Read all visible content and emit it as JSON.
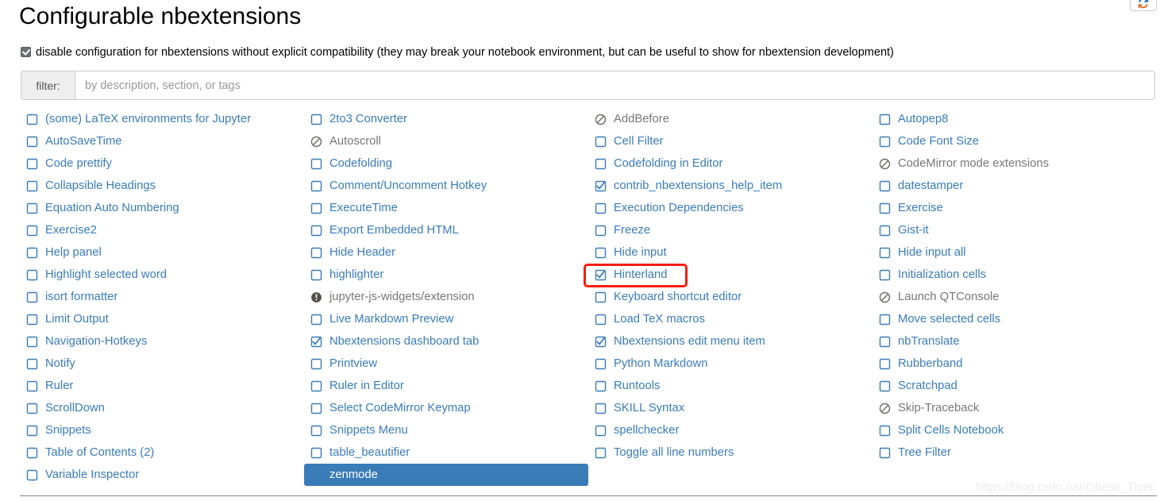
{
  "header": {
    "title": "Configurable nbextensions",
    "refresh_icon": "refresh-icon",
    "disable_config_label": "disable configuration for nbextensions without explicit compatibility (they may break your notebook environment, but can be useful to show for nbextension development)",
    "disable_config_checked": true
  },
  "filter": {
    "label": "filter:",
    "placeholder": "by description, section, or tags",
    "value": ""
  },
  "colors": {
    "link": "#3a7cb8",
    "disabled_text": "#777777",
    "selected_bg": "#3a7cb8",
    "annotation": "#f61d0d",
    "watermark": "#ececec"
  },
  "watermark": "https://blog.csdn.net/Obese_Tiger",
  "annotation": {
    "target": "Hinterland",
    "shape": "rectangle"
  },
  "columns": [
    {
      "items": [
        {
          "label": "(some) LaTeX environments for Jupyter",
          "state": "unchecked",
          "icon": "checkbox-unchecked-icon"
        },
        {
          "label": "AutoSaveTime",
          "state": "unchecked",
          "icon": "checkbox-unchecked-icon"
        },
        {
          "label": "Code prettify",
          "state": "unchecked",
          "icon": "checkbox-unchecked-icon"
        },
        {
          "label": "Collapsible Headings",
          "state": "unchecked",
          "icon": "checkbox-unchecked-icon"
        },
        {
          "label": "Equation Auto Numbering",
          "state": "unchecked",
          "icon": "checkbox-unchecked-icon"
        },
        {
          "label": "Exercise2",
          "state": "unchecked",
          "icon": "checkbox-unchecked-icon"
        },
        {
          "label": "Help panel",
          "state": "unchecked",
          "icon": "checkbox-unchecked-icon"
        },
        {
          "label": "Highlight selected word",
          "state": "unchecked",
          "icon": "checkbox-unchecked-icon"
        },
        {
          "label": "isort formatter",
          "state": "unchecked",
          "icon": "checkbox-unchecked-icon"
        },
        {
          "label": "Limit Output",
          "state": "unchecked",
          "icon": "checkbox-unchecked-icon"
        },
        {
          "label": "Navigation-Hotkeys",
          "state": "unchecked",
          "icon": "checkbox-unchecked-icon"
        },
        {
          "label": "Notify",
          "state": "unchecked",
          "icon": "checkbox-unchecked-icon"
        },
        {
          "label": "Ruler",
          "state": "unchecked",
          "icon": "checkbox-unchecked-icon"
        },
        {
          "label": "ScrollDown",
          "state": "unchecked",
          "icon": "checkbox-unchecked-icon"
        },
        {
          "label": "Snippets",
          "state": "unchecked",
          "icon": "checkbox-unchecked-icon"
        },
        {
          "label": "Table of Contents (2)",
          "state": "unchecked",
          "icon": "checkbox-unchecked-icon"
        },
        {
          "label": "Variable Inspector",
          "state": "unchecked",
          "icon": "checkbox-unchecked-icon"
        }
      ]
    },
    {
      "items": [
        {
          "label": "2to3 Converter",
          "state": "unchecked",
          "icon": "checkbox-unchecked-icon"
        },
        {
          "label": "Autoscroll",
          "state": "incompatible",
          "icon": "ban-icon"
        },
        {
          "label": "Codefolding",
          "state": "unchecked",
          "icon": "checkbox-unchecked-icon"
        },
        {
          "label": "Comment/Uncomment Hotkey",
          "state": "unchecked",
          "icon": "checkbox-unchecked-icon"
        },
        {
          "label": "ExecuteTime",
          "state": "unchecked",
          "icon": "checkbox-unchecked-icon"
        },
        {
          "label": "Export Embedded HTML",
          "state": "unchecked",
          "icon": "checkbox-unchecked-icon"
        },
        {
          "label": "Hide Header",
          "state": "unchecked",
          "icon": "checkbox-unchecked-icon"
        },
        {
          "label": "highlighter",
          "state": "unchecked",
          "icon": "checkbox-unchecked-icon"
        },
        {
          "label": "jupyter-js-widgets/extension",
          "state": "warning",
          "icon": "exclamation-circle-icon"
        },
        {
          "label": "Live Markdown Preview",
          "state": "unchecked",
          "icon": "checkbox-unchecked-icon"
        },
        {
          "label": "Nbextensions dashboard tab",
          "state": "checked",
          "icon": "checkbox-checked-icon"
        },
        {
          "label": "Printview",
          "state": "unchecked",
          "icon": "checkbox-unchecked-icon"
        },
        {
          "label": "Ruler in Editor",
          "state": "unchecked",
          "icon": "checkbox-unchecked-icon"
        },
        {
          "label": "Select CodeMirror Keymap",
          "state": "unchecked",
          "icon": "checkbox-unchecked-icon"
        },
        {
          "label": "Snippets Menu",
          "state": "unchecked",
          "icon": "checkbox-unchecked-icon"
        },
        {
          "label": "table_beautifier",
          "state": "unchecked",
          "icon": "checkbox-unchecked-icon"
        },
        {
          "label": "zenmode",
          "state": "unchecked",
          "icon": "checkbox-unchecked-icon",
          "selected": true
        }
      ]
    },
    {
      "items": [
        {
          "label": "AddBefore",
          "state": "incompatible",
          "icon": "ban-icon"
        },
        {
          "label": "Cell Filter",
          "state": "unchecked",
          "icon": "checkbox-unchecked-icon"
        },
        {
          "label": "Codefolding in Editor",
          "state": "unchecked",
          "icon": "checkbox-unchecked-icon"
        },
        {
          "label": "contrib_nbextensions_help_item",
          "state": "checked",
          "icon": "checkbox-checked-icon"
        },
        {
          "label": "Execution Dependencies",
          "state": "unchecked",
          "icon": "checkbox-unchecked-icon"
        },
        {
          "label": "Freeze",
          "state": "unchecked",
          "icon": "checkbox-unchecked-icon"
        },
        {
          "label": "Hide input",
          "state": "unchecked",
          "icon": "checkbox-unchecked-icon"
        },
        {
          "label": "Hinterland",
          "state": "checked",
          "icon": "checkbox-checked-icon",
          "annotated": true
        },
        {
          "label": "Keyboard shortcut editor",
          "state": "unchecked",
          "icon": "checkbox-unchecked-icon"
        },
        {
          "label": "Load TeX macros",
          "state": "unchecked",
          "icon": "checkbox-unchecked-icon"
        },
        {
          "label": "Nbextensions edit menu item",
          "state": "checked",
          "icon": "checkbox-checked-icon"
        },
        {
          "label": "Python Markdown",
          "state": "unchecked",
          "icon": "checkbox-unchecked-icon"
        },
        {
          "label": "Runtools",
          "state": "unchecked",
          "icon": "checkbox-unchecked-icon"
        },
        {
          "label": "SKILL Syntax",
          "state": "unchecked",
          "icon": "checkbox-unchecked-icon"
        },
        {
          "label": "spellchecker",
          "state": "unchecked",
          "icon": "checkbox-unchecked-icon"
        },
        {
          "label": "Toggle all line numbers",
          "state": "unchecked",
          "icon": "checkbox-unchecked-icon"
        }
      ]
    },
    {
      "items": [
        {
          "label": "Autopep8",
          "state": "unchecked",
          "icon": "checkbox-unchecked-icon"
        },
        {
          "label": "Code Font Size",
          "state": "unchecked",
          "icon": "checkbox-unchecked-icon"
        },
        {
          "label": "CodeMirror mode extensions",
          "state": "incompatible",
          "icon": "ban-icon"
        },
        {
          "label": "datestamper",
          "state": "unchecked",
          "icon": "checkbox-unchecked-icon"
        },
        {
          "label": "Exercise",
          "state": "unchecked",
          "icon": "checkbox-unchecked-icon"
        },
        {
          "label": "Gist-it",
          "state": "unchecked",
          "icon": "checkbox-unchecked-icon"
        },
        {
          "label": "Hide input all",
          "state": "unchecked",
          "icon": "checkbox-unchecked-icon"
        },
        {
          "label": "Initialization cells",
          "state": "unchecked",
          "icon": "checkbox-unchecked-icon"
        },
        {
          "label": "Launch QTConsole",
          "state": "incompatible",
          "icon": "ban-icon"
        },
        {
          "label": "Move selected cells",
          "state": "unchecked",
          "icon": "checkbox-unchecked-icon"
        },
        {
          "label": "nbTranslate",
          "state": "unchecked",
          "icon": "checkbox-unchecked-icon"
        },
        {
          "label": "Rubberband",
          "state": "unchecked",
          "icon": "checkbox-unchecked-icon"
        },
        {
          "label": "Scratchpad",
          "state": "unchecked",
          "icon": "checkbox-unchecked-icon"
        },
        {
          "label": "Skip-Traceback",
          "state": "incompatible",
          "icon": "ban-icon"
        },
        {
          "label": "Split Cells Notebook",
          "state": "unchecked",
          "icon": "checkbox-unchecked-icon"
        },
        {
          "label": "Tree Filter",
          "state": "unchecked",
          "icon": "checkbox-unchecked-icon"
        }
      ]
    }
  ]
}
